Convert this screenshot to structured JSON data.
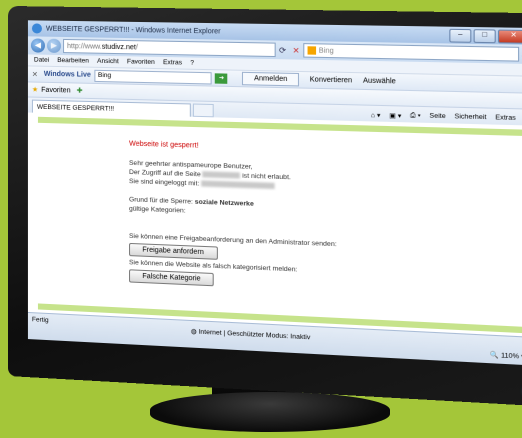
{
  "window": {
    "title": "WEBSEITE GESPERRT!!! - Windows Internet Explorer",
    "controls": {
      "minimize": "–",
      "maximize": "□",
      "close": "✕"
    }
  },
  "address_bar": {
    "url_prefix": "http://www.",
    "url_domain": "studivz.net",
    "url_suffix": "/",
    "search_placeholder": "Bing"
  },
  "menu": [
    "Datei",
    "Bearbeiten",
    "Ansicht",
    "Favoriten",
    "Extras",
    "?"
  ],
  "toolbar": {
    "windows_live": "Windows Live",
    "search_value": "Bing",
    "anmelden": "Anmelden",
    "konvertieren": "Konvertieren",
    "auswaehlen": "Auswähle"
  },
  "favorites": {
    "label": "Favoriten"
  },
  "tab": {
    "title": "WEBSEITE GESPERRT!!!"
  },
  "command_bar": {
    "seite": "Seite",
    "sicherheit": "Sicherheit",
    "extras": "Extras"
  },
  "content": {
    "heading": "Webseite ist gesperrt!",
    "greeting": "Sehr geehrter antispameurope Benutzer,",
    "access_prefix": "Der Zugriff auf die Seite",
    "access_suffix": "ist nicht erlaubt.",
    "logged_in": "Sie sind eingeloggt mit:",
    "reason_label": "Grund für die Sperre:",
    "reason_value": "soziale Netzwerke",
    "categories_label": "gültige Kategorien:",
    "request_text": "Sie können eine Freigabeanforderung an den Administrator senden:",
    "request_button": "Freigabe anfordern",
    "report_text": "Sie können die Website als falsch kategorisiert melden:",
    "report_button": "Falsche Kategorie"
  },
  "status": {
    "left": "Fertig",
    "zone": "Internet | Geschützter Modus: Inaktiv",
    "zoom": "110%"
  },
  "colors": {
    "background": "#a4c639",
    "heading": "#cc0000",
    "accent_bar": "#c6e38b"
  }
}
